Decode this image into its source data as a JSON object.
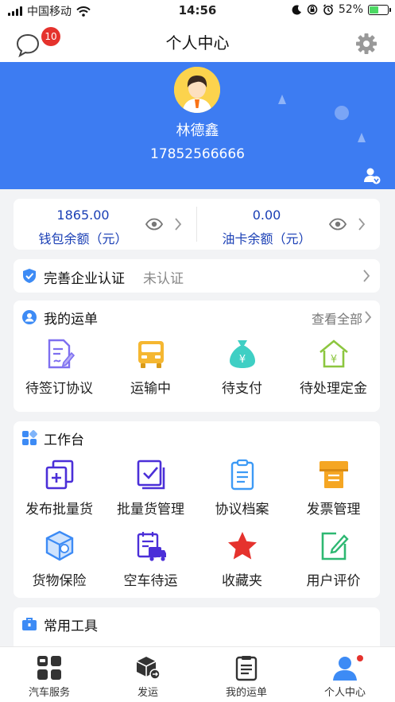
{
  "status_bar": {
    "carrier": "中国移动",
    "time": "14:56",
    "battery": "52%",
    "battery_level": 0.52,
    "icons": [
      "signal-icon",
      "wifi-icon",
      "moon-icon",
      "lock-rotation-icon",
      "alarm-icon",
      "battery-icon"
    ]
  },
  "header": {
    "title": "个人中心",
    "message_badge": "10",
    "icons": [
      "message-icon",
      "gear-icon"
    ]
  },
  "profile": {
    "name": "林德鑫",
    "phone": "17852566666",
    "background_color": "#3d7cf2"
  },
  "balances": {
    "wallet_value": "1865.00",
    "wallet_label": "钱包余额（元）",
    "fuel_value": "0.00",
    "fuel_label": "油卡余额（元）",
    "accent_color": "#1a3fb5"
  },
  "auth": {
    "title": "完善企业认证",
    "status": "未认证"
  },
  "orders": {
    "title": "我的运单",
    "view_all": "查看全部",
    "items": [
      {
        "label": "待签订协议",
        "icon": "contract-sign-icon"
      },
      {
        "label": "运输中",
        "icon": "truck-icon"
      },
      {
        "label": "待支付",
        "icon": "money-bag-icon"
      },
      {
        "label": "待处理定金",
        "icon": "house-yuan-icon"
      }
    ]
  },
  "workbench": {
    "title": "工作台",
    "items": [
      {
        "label": "发布批量货",
        "icon": "add-document-icon"
      },
      {
        "label": "批量货管理",
        "icon": "checklist-icon"
      },
      {
        "label": "协议档案",
        "icon": "clipboard-icon"
      },
      {
        "label": "发票管理",
        "icon": "invoice-printer-icon"
      },
      {
        "label": "货物保险",
        "icon": "insured-box-icon"
      },
      {
        "label": "空车待运",
        "icon": "empty-truck-schedule-icon"
      },
      {
        "label": "收藏夹",
        "icon": "star-icon"
      },
      {
        "label": "用户评价",
        "icon": "edit-review-icon"
      }
    ]
  },
  "tools": {
    "title": "常用工具"
  },
  "tab_bar": {
    "tabs": [
      {
        "label": "汽车服务",
        "icon": "car-service-icon"
      },
      {
        "label": "发运",
        "icon": "ship-box-icon"
      },
      {
        "label": "我的运单",
        "icon": "waybill-icon"
      },
      {
        "label": "个人中心",
        "icon": "user-icon",
        "active": true
      }
    ],
    "active_color": "#3d7cf2"
  }
}
